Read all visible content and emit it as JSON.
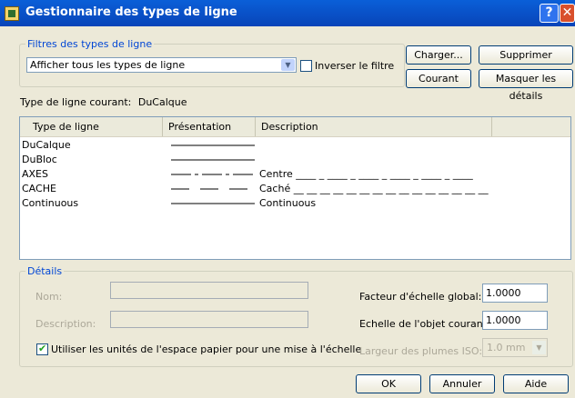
{
  "window": {
    "title": "Gestionnaire des types de ligne",
    "help_label": "?",
    "close_label": "✕"
  },
  "filters": {
    "legend": "Filtres des types de ligne",
    "selected": "Afficher tous les types de ligne",
    "invert_label": "Inverser le filtre",
    "invert_checked": false
  },
  "buttons": {
    "load": "Charger...",
    "delete": "Supprimer",
    "current": "Courant",
    "hide_details": "Masquer les détails",
    "ok": "OK",
    "cancel": "Annuler",
    "help": "Aide"
  },
  "current_linetype": {
    "label": "Type de ligne courant:",
    "value": "DuCalque"
  },
  "table": {
    "headers": [
      "Type de ligne",
      "Présentation",
      "Description"
    ],
    "rows": [
      {
        "name": "DuCalque",
        "pattern": "solid",
        "description": ""
      },
      {
        "name": "DuBloc",
        "pattern": "solid",
        "description": ""
      },
      {
        "name": "AXES",
        "pattern": "center",
        "description": "Centre ____ _ ____ _ ____ _ ____ _ ____ _ ____"
      },
      {
        "name": "CACHE",
        "pattern": "hidden",
        "description": "Caché __ __ __ __ __ __ __ __ __ __ __ __ __ __ __"
      },
      {
        "name": "Continuous",
        "pattern": "solid",
        "description": "Continuous"
      }
    ]
  },
  "details": {
    "legend": "Détails",
    "name_label": "Nom:",
    "description_label": "Description:",
    "global_scale_label": "Facteur d'échelle global:",
    "global_scale_value": "1.0000",
    "object_scale_label": "Echelle de l'objet courant:",
    "object_scale_value": "1.0000",
    "paperspace_label": "Utiliser les unités de l'espace papier pour une mise à l'échelle",
    "paperspace_checked": true,
    "pen_width_label": "Largeur des plumes ISO:",
    "pen_width_value": "1.0 mm"
  }
}
